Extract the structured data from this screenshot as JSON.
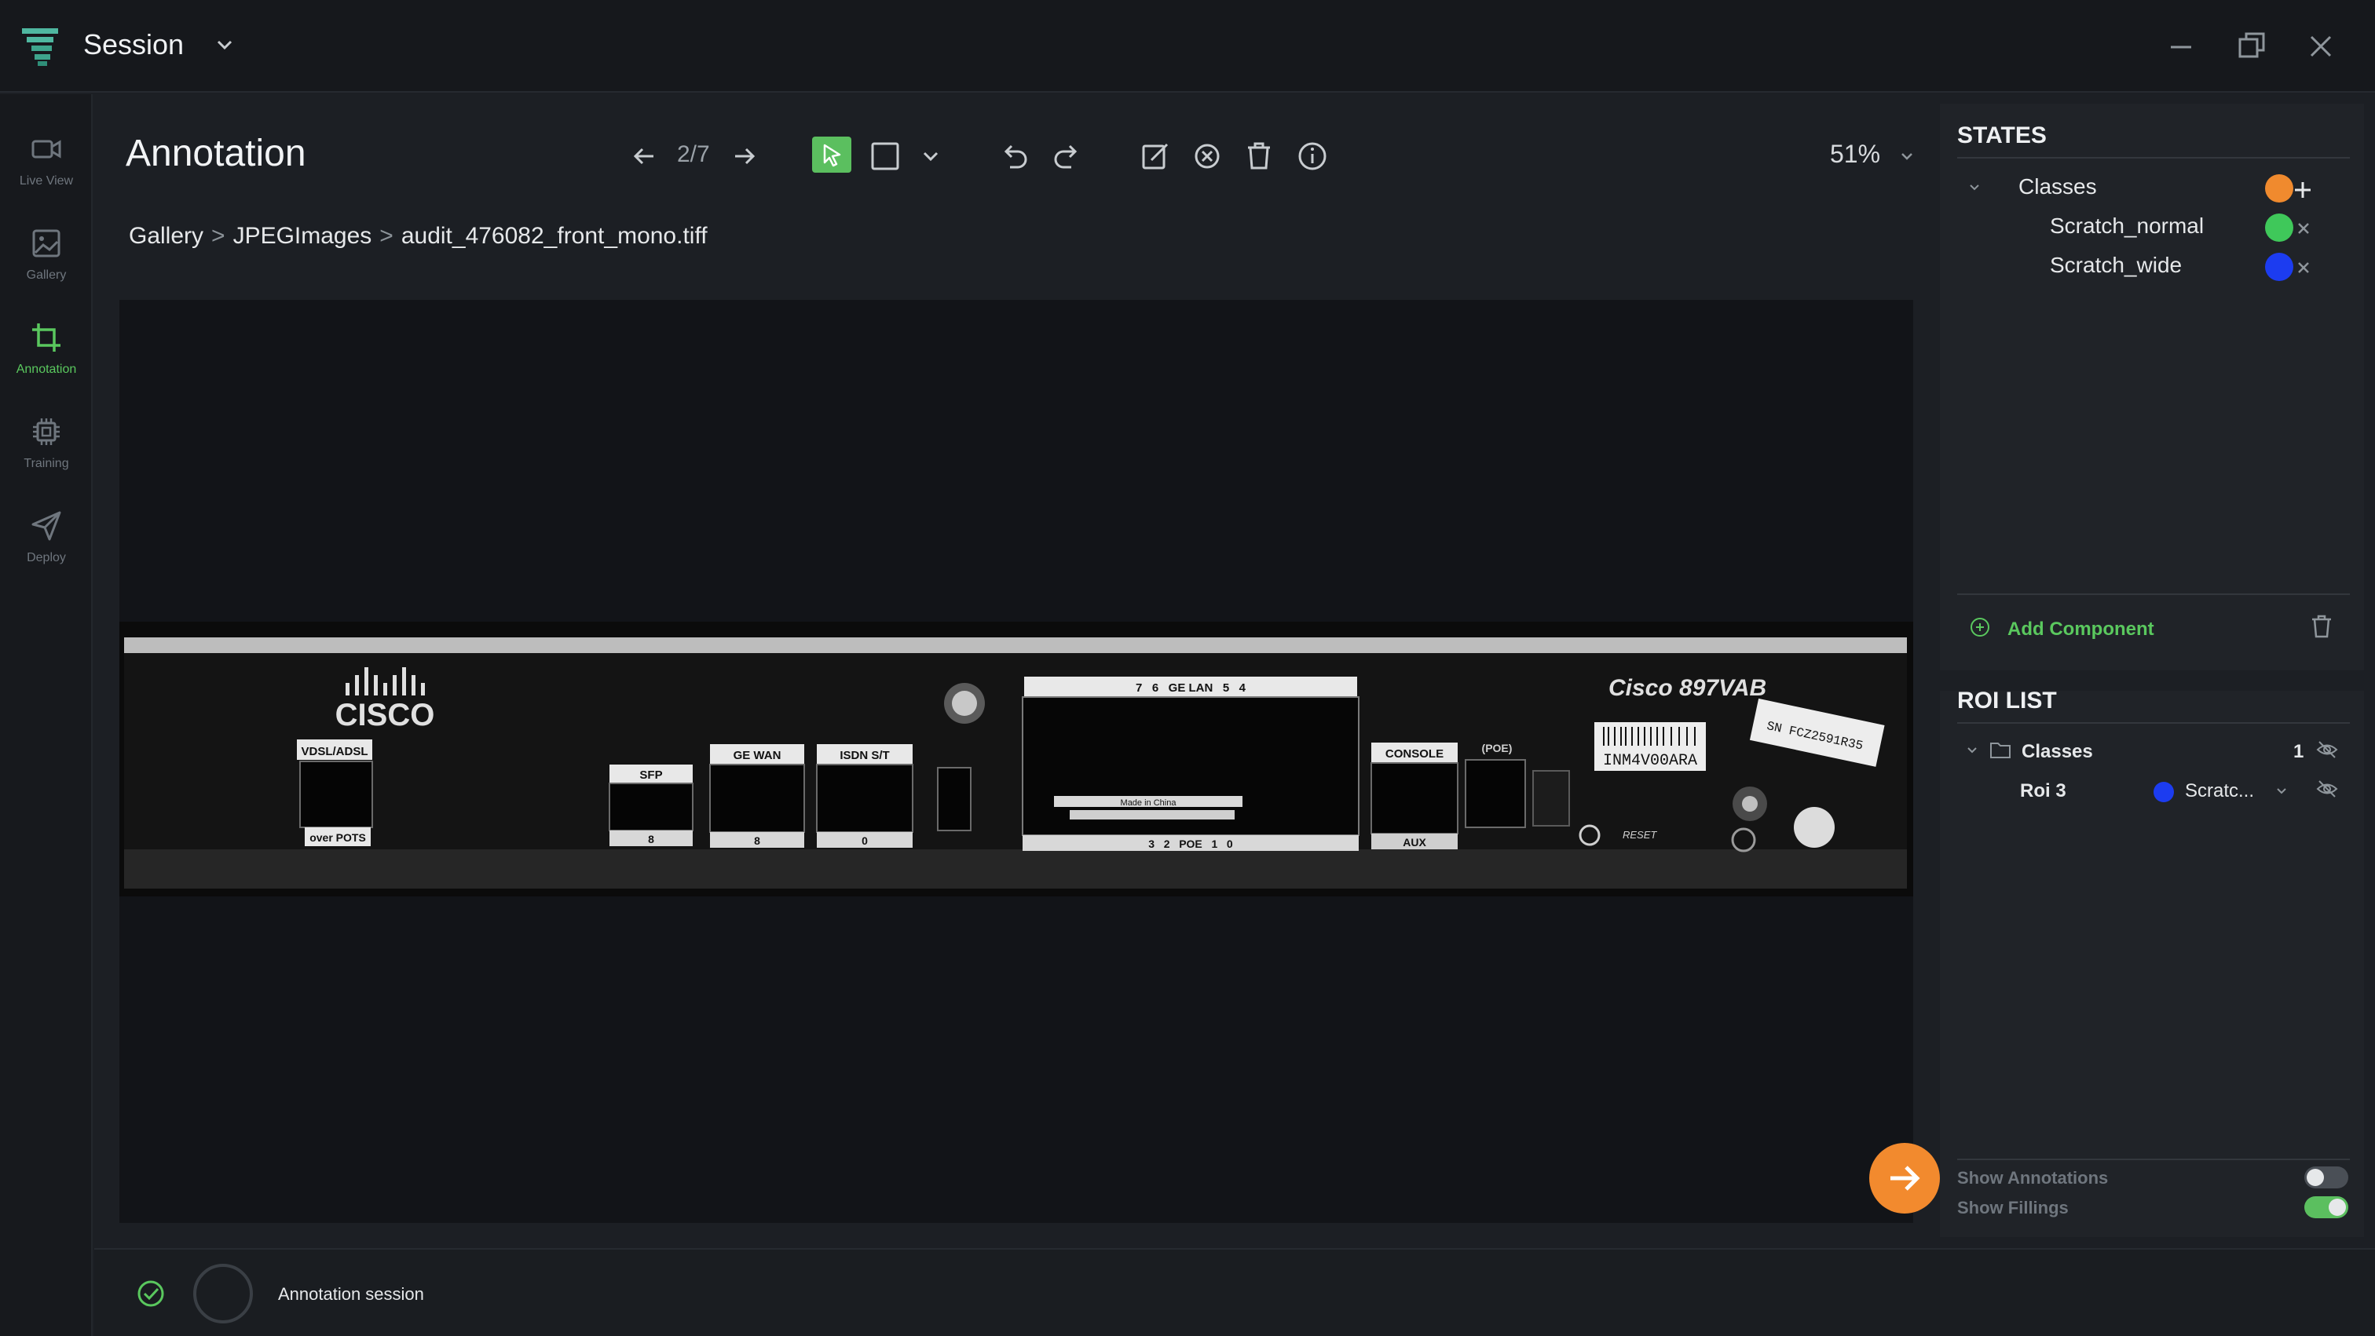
{
  "window": {
    "title": "Session"
  },
  "nav": {
    "items": [
      {
        "label": "Live View",
        "icon": "video-camera-icon"
      },
      {
        "label": "Gallery",
        "icon": "image-icon"
      },
      {
        "label": "Annotation",
        "icon": "crop-icon",
        "active": true
      },
      {
        "label": "Training",
        "icon": "chip-icon"
      },
      {
        "label": "Deploy",
        "icon": "paper-plane-icon"
      }
    ]
  },
  "header": {
    "title": "Annotation",
    "counter": "2/7",
    "zoom": "51%"
  },
  "breadcrumb": [
    "Gallery",
    "JPEGImages",
    "audit_476082_front_mono.tiff"
  ],
  "device_image": {
    "brand": "CISCO",
    "model": "Cisco 897VAB",
    "labels": {
      "vdsl": "VDSL/ADSL",
      "pots": "over POTS",
      "sfp": "SFP",
      "gewan": "GE WAN",
      "isdn": "ISDN S/T",
      "gelan": "7   6   GE LAN   5   4",
      "poe_bottom": "3   2   POE   1   0",
      "console": "CONSOLE",
      "aux": "AUX",
      "poe": "(POE)",
      "reset": "RESET",
      "barcode1": "INM4V00ARA",
      "barcode2": "SN FCZ2591R35",
      "made_in": "Made in China",
      "n8a": "8",
      "n8b": "8",
      "n0": "0"
    }
  },
  "states": {
    "heading": "STATES",
    "group": {
      "label": "Classes",
      "color": "#f08a2e"
    },
    "classes": [
      {
        "label": "Scratch_normal",
        "color": "#3fc85a"
      },
      {
        "label": "Scratch_wide",
        "color": "#1c3cf0"
      }
    ],
    "add_component": "Add Component"
  },
  "roi_list": {
    "heading": "ROI LIST",
    "group": {
      "label": "Classes",
      "count": "1"
    },
    "items": [
      {
        "label": "Roi 3",
        "class_short": "Scratc...",
        "color": "#1c3cf0"
      }
    ]
  },
  "toggles": {
    "show_annotations": {
      "label": "Show Annotations",
      "on": false
    },
    "show_fillings": {
      "label": "Show Fillings",
      "on": true
    }
  },
  "footer": {
    "status": "Annotation session"
  },
  "colors": {
    "accent": "#5bbf5f",
    "fab": "#f28a2e"
  }
}
